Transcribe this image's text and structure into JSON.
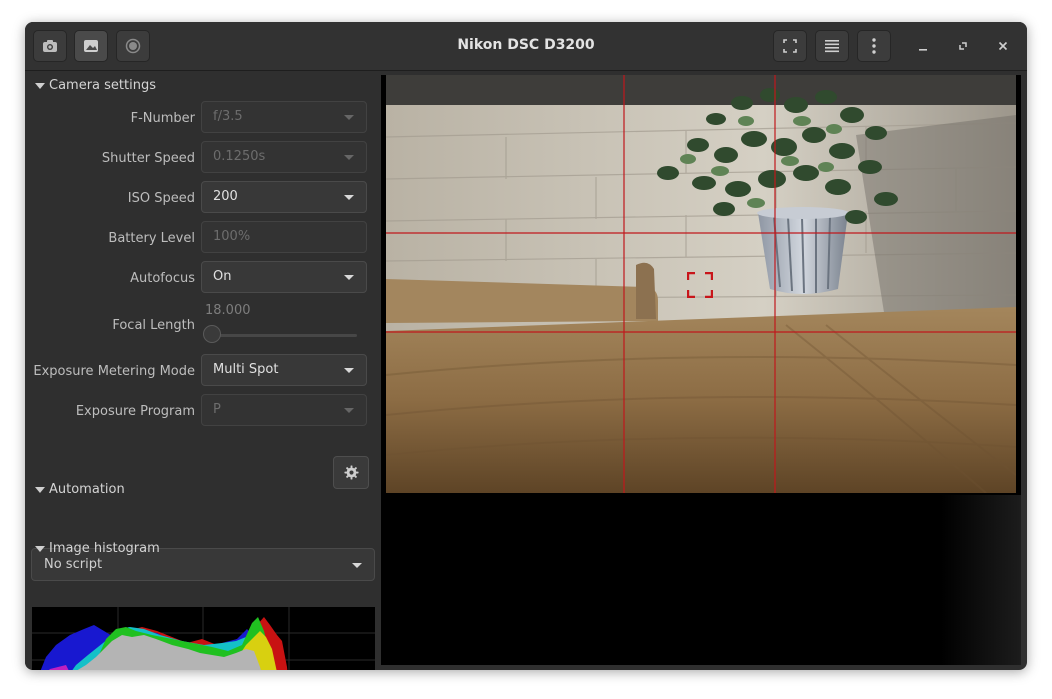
{
  "window": {
    "title": "Nikon DSC D3200"
  },
  "toolbar": {
    "left_icons": [
      "camera-icon",
      "image-icon",
      "record-icon"
    ],
    "right_icons": [
      "fullscreen-icon",
      "menu-lines-icon",
      "more-vertical-icon"
    ],
    "window_controls": [
      "minimize-icon",
      "restore-icon",
      "close-icon"
    ]
  },
  "sections": {
    "camera": "Camera settings",
    "automation": "Automation",
    "histogram": "Image histogram"
  },
  "settings": {
    "fnumber_label": "F-Number",
    "fnumber_value": "f/3.5",
    "shutter_label": "Shutter Speed",
    "shutter_value": "0.1250s",
    "iso_label": "ISO Speed",
    "iso_value": "200",
    "battery_label": "Battery Level",
    "battery_value": "100%",
    "autofocus_label": "Autofocus",
    "autofocus_value": "On",
    "focal_label": "Focal Length",
    "focal_value": "18.000",
    "focal_position": 0,
    "metering_label": "Exposure Metering Mode",
    "metering_value": "Multi Spot",
    "program_label": "Exposure Program",
    "program_value": "P"
  },
  "automation": {
    "script_value": "No script"
  },
  "colors": {
    "accent_grid": "#c0181c",
    "background": "#2f2f2f"
  }
}
